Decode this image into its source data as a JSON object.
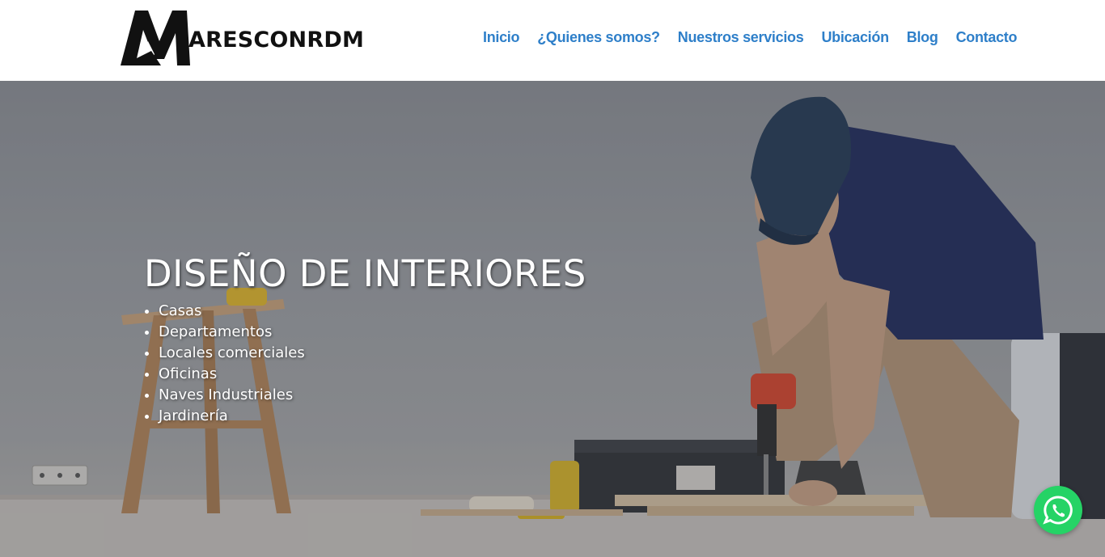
{
  "header": {
    "logo": {
      "text": "ARESCONRDM",
      "icon": "maresconrdm-logo-icon"
    },
    "nav": [
      {
        "label": "Inicio"
      },
      {
        "label": "¿Quienes somos?"
      },
      {
        "label": "Nuestros servicios"
      },
      {
        "label": "Ubicación"
      },
      {
        "label": "Blog"
      },
      {
        "label": "Contacto"
      }
    ]
  },
  "hero": {
    "title": "DISEÑO DE INTERIORES",
    "items": [
      "Casas",
      "Departamentos",
      "Locales comerciales",
      "Oficinas",
      "Naves Industriales",
      "Jardinería"
    ],
    "background": "worker-drilling-wood-photo"
  },
  "whatsapp": {
    "icon": "whatsapp-icon",
    "color": "#25d366"
  },
  "colors": {
    "nav_link": "#2e7fc9",
    "hero_text": "#ffffff"
  }
}
